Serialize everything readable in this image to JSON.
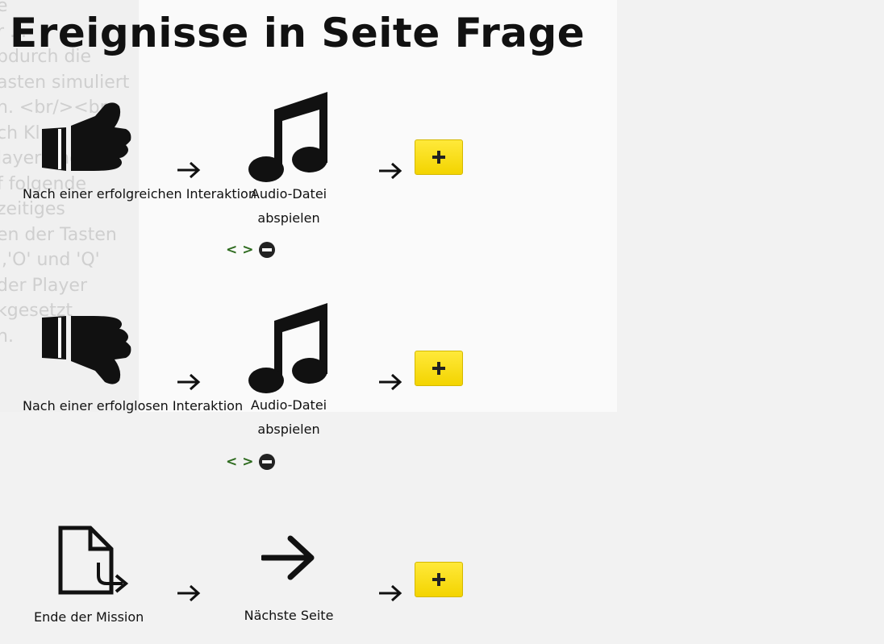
{
  "background_text": "e\nr ... \nbdurch die\nasten simuliert\nn. <br/><br\nch Kl\nlayer und ein\nf folgende\nzeitiges\nen der Tasten\n','O' und 'Q'\nder Player\nkgesetzt\nn.",
  "title": "Ereignisse in Seite Frage",
  "rules": [
    {
      "trigger_label": "Nach einer erfolgreichen Interaktion",
      "trigger_icon": "thumbs-up-icon",
      "action_label_line1": "Audio-Datei",
      "action_label_line2": "abspielen",
      "action_icon": "music-note-icon",
      "nav": {
        "prev": "<",
        "next": ">"
      }
    },
    {
      "trigger_label": "Nach einer erfolglosen Interaktion",
      "trigger_icon": "thumbs-down-icon",
      "action_label_line1": "Audio-Datei",
      "action_label_line2": "abspielen",
      "action_icon": "music-note-icon",
      "nav": {
        "prev": "<",
        "next": ">"
      }
    },
    {
      "trigger_label": "Ende der Mission",
      "trigger_icon": "document-exit-icon",
      "action_label_line1": "Nächste Seite",
      "action_icon": "arrow-right-icon"
    }
  ],
  "colors": {
    "add_button": "#ffe600",
    "nav_link": "#2e6b1f"
  }
}
